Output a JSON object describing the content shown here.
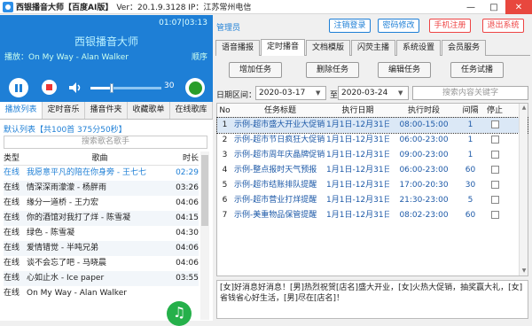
{
  "window": {
    "title": "西银播音大师【百度AI版】",
    "version": "Ver：20.1.9.3128  IP：江苏常州电信",
    "minimize": "—",
    "maximize": "□",
    "close": "✕"
  },
  "player": {
    "time": "01:07|03:13",
    "app_name": "西银播音大师",
    "now_playing": "播放：On My Way - Alan Walker",
    "play_order": "顺序",
    "volume": "30",
    "volume_level": 0.3
  },
  "left_tabs": [
    "播放列表",
    "定时音乐",
    "播音件夹",
    "收藏歌单",
    "在线歌库"
  ],
  "playlist": {
    "header": "默认列表【共100首 375分50秒】",
    "search_placeholder": "搜索歌名歌手",
    "columns": [
      "类型",
      "歌曲",
      "时长"
    ],
    "rows": [
      {
        "type": "在线",
        "song": "我愿意平凡的陪在你身旁 - 王七七",
        "dur": "02:29"
      },
      {
        "type": "在线",
        "song": "情深深雨濛濛 - 杨胖雨",
        "dur": "03:26"
      },
      {
        "type": "在线",
        "song": "缘分一道桥 - 王力宏",
        "dur": "04:06"
      },
      {
        "type": "在线",
        "song": "你的酒馆对我打了烊 - 陈雪凝",
        "dur": "04:15"
      },
      {
        "type": "在线",
        "song": "绿色 - 陈雪凝",
        "dur": "04:30"
      },
      {
        "type": "在线",
        "song": "爱情错觉 - 半吨兄弟",
        "dur": "04:06"
      },
      {
        "type": "在线",
        "song": "谈不会忘了吧 - 马晓晨",
        "dur": "04:06"
      },
      {
        "type": "在线",
        "song": "心如止水 - Ice paper",
        "dur": "03:55"
      },
      {
        "type": "在线",
        "song": "On My Way - Alan Walker",
        "dur": ""
      }
    ]
  },
  "right": {
    "admin": "管理员",
    "buttons": [
      "注销登录",
      "密码修改",
      "手机注册",
      "退出系统"
    ],
    "tabs": [
      "语音播报",
      "定时播音",
      "文档模版",
      "闪荧主播",
      "系统设置",
      "会员服务"
    ],
    "actions": [
      "增加任务",
      "删除任务",
      "编辑任务",
      "任务试播"
    ],
    "date_label": "日期区间：",
    "date_from": "2020-03-17",
    "date_to_label": "至",
    "date_to": "2020-03-24",
    "search_placeholder": "搜索内容关键字",
    "columns": [
      "No",
      "任务标题",
      "执行日期",
      "执行时段",
      "间隔",
      "停止"
    ],
    "tasks": [
      {
        "no": "1",
        "title": "示例-超市盛大开业大促销",
        "date": "1月1日-12月31日",
        "time": "08:00-15:00",
        "int": "1"
      },
      {
        "no": "2",
        "title": "示例-超市节日疯狂大促销",
        "date": "1月1日-12月31日",
        "time": "06:00-23:00",
        "int": "1"
      },
      {
        "no": "3",
        "title": "示例-超市周年庆晶牌促销",
        "date": "1月1日-12月31日",
        "time": "09:00-23:00",
        "int": "1"
      },
      {
        "no": "4",
        "title": "示例-整点报时天气预报",
        "date": "1月1日-12月31日",
        "time": "06:00-23:00",
        "int": "60"
      },
      {
        "no": "5",
        "title": "示例-超市结账排队提醒",
        "date": "1月1日-12月31日",
        "time": "17:00-20:30",
        "int": "30"
      },
      {
        "no": "6",
        "title": "示例-超市营业打烊提醒",
        "date": "1月1日-12月31日",
        "time": "21:30-23:00",
        "int": "5"
      },
      {
        "no": "7",
        "title": "示例-美重物品保管提醒",
        "date": "1月1日-12月31日",
        "time": "08:02-23:00",
        "int": "60"
      }
    ],
    "text_content": "[女]好消息好消息！[男]热烈祝贺[店名]盛大开业，[女]火热大促销，抽奖赢大礼，[女]省钱省心好生活，[男]尽在[店名]！"
  }
}
